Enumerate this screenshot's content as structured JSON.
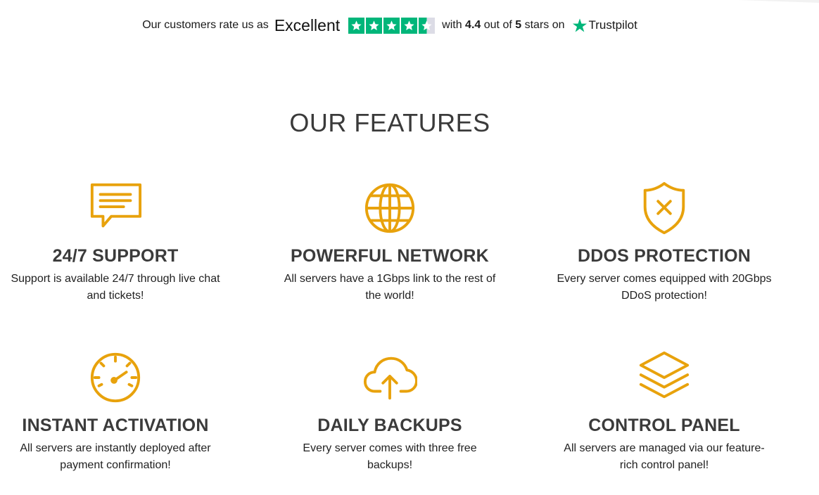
{
  "trustpilot": {
    "prefix": "Our customers rate us as",
    "rating_word": "Excellent",
    "with": "with",
    "score": "4.4",
    "out_of": "out of",
    "max": "5",
    "stars_on": "stars on",
    "brand": "Trustpilot",
    "stars_filled": 4.5,
    "star_color": "#00b67a"
  },
  "section_title": "OUR FEATURES",
  "accent_color": "#e8a20c",
  "features": [
    {
      "title": "24/7 SUPPORT",
      "desc": "Support is available 24/7 through live chat and tickets!",
      "icon": "chat-icon"
    },
    {
      "title": "POWERFUL NETWORK",
      "desc": "All servers have a 1Gbps link to the rest of the world!",
      "icon": "globe-icon"
    },
    {
      "title": "DDOS PROTECTION",
      "desc": "Every server comes equipped with 20Gbps DDoS protection!",
      "icon": "shield-icon"
    },
    {
      "title": "INSTANT ACTIVATION",
      "desc": "All servers are instantly deployed after payment confirmation!",
      "icon": "speedometer-icon"
    },
    {
      "title": "DAILY BACKUPS",
      "desc": "Every server comes with three free backups!",
      "icon": "cloud-upload-icon"
    },
    {
      "title": "CONTROL PANEL",
      "desc": "All servers are managed via our feature-rich control panel!",
      "icon": "layers-icon"
    }
  ]
}
